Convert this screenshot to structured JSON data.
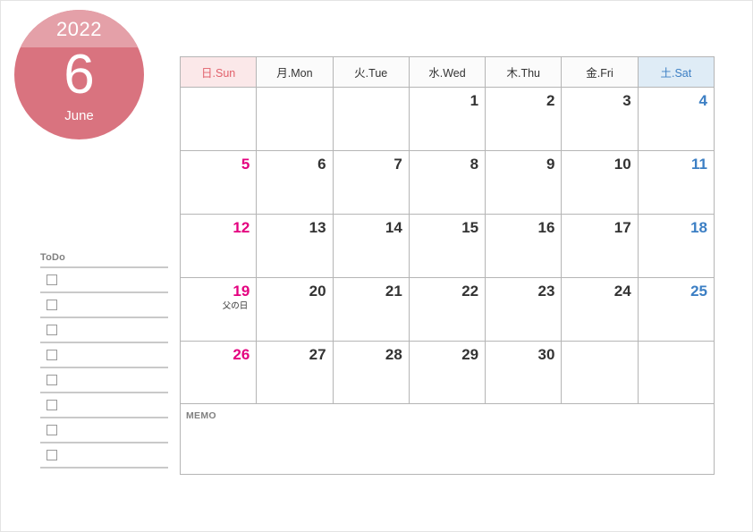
{
  "badge": {
    "year": "2022",
    "month_number": "6",
    "month_name": "June",
    "top_color": "#e4a0a8",
    "bottom_color": "#d9737f"
  },
  "todo": {
    "title": "ToDo",
    "rows": [
      "",
      "",
      "",
      "",
      "",
      "",
      "",
      ""
    ]
  },
  "calendar": {
    "weekday_headers": [
      {
        "label": "日.Sun",
        "kind": "sun"
      },
      {
        "label": "月.Mon",
        "kind": "weekday"
      },
      {
        "label": "火.Tue",
        "kind": "weekday"
      },
      {
        "label": "水.Wed",
        "kind": "weekday"
      },
      {
        "label": "木.Thu",
        "kind": "weekday"
      },
      {
        "label": "金.Fri",
        "kind": "weekday"
      },
      {
        "label": "土.Sat",
        "kind": "sat"
      }
    ],
    "weeks": [
      [
        {
          "date": "",
          "note": ""
        },
        {
          "date": "",
          "note": ""
        },
        {
          "date": "",
          "note": ""
        },
        {
          "date": "1",
          "note": ""
        },
        {
          "date": "2",
          "note": ""
        },
        {
          "date": "3",
          "note": ""
        },
        {
          "date": "4",
          "note": ""
        }
      ],
      [
        {
          "date": "5",
          "note": ""
        },
        {
          "date": "6",
          "note": ""
        },
        {
          "date": "7",
          "note": ""
        },
        {
          "date": "8",
          "note": ""
        },
        {
          "date": "9",
          "note": ""
        },
        {
          "date": "10",
          "note": ""
        },
        {
          "date": "11",
          "note": ""
        }
      ],
      [
        {
          "date": "12",
          "note": ""
        },
        {
          "date": "13",
          "note": ""
        },
        {
          "date": "14",
          "note": ""
        },
        {
          "date": "15",
          "note": ""
        },
        {
          "date": "16",
          "note": ""
        },
        {
          "date": "17",
          "note": ""
        },
        {
          "date": "18",
          "note": ""
        }
      ],
      [
        {
          "date": "19",
          "note": "父の日"
        },
        {
          "date": "20",
          "note": ""
        },
        {
          "date": "21",
          "note": ""
        },
        {
          "date": "22",
          "note": ""
        },
        {
          "date": "23",
          "note": ""
        },
        {
          "date": "24",
          "note": ""
        },
        {
          "date": "25",
          "note": ""
        }
      ],
      [
        {
          "date": "26",
          "note": ""
        },
        {
          "date": "27",
          "note": ""
        },
        {
          "date": "28",
          "note": ""
        },
        {
          "date": "29",
          "note": ""
        },
        {
          "date": "30",
          "note": ""
        },
        {
          "date": "",
          "note": ""
        },
        {
          "date": "",
          "note": ""
        }
      ]
    ],
    "colors": {
      "sunday_text": "#e4007f",
      "saturday_text": "#3c7fc4",
      "sunday_header_bg": "#fbe8e9",
      "sunday_header_text": "#e2606b",
      "saturday_header_bg": "#dfecf6",
      "saturday_header_text": "#3c7fc4",
      "grid_line": "#b5b5b5",
      "weekday_text": "#333333"
    }
  },
  "memo": {
    "label": "MEMO",
    "content": ""
  }
}
